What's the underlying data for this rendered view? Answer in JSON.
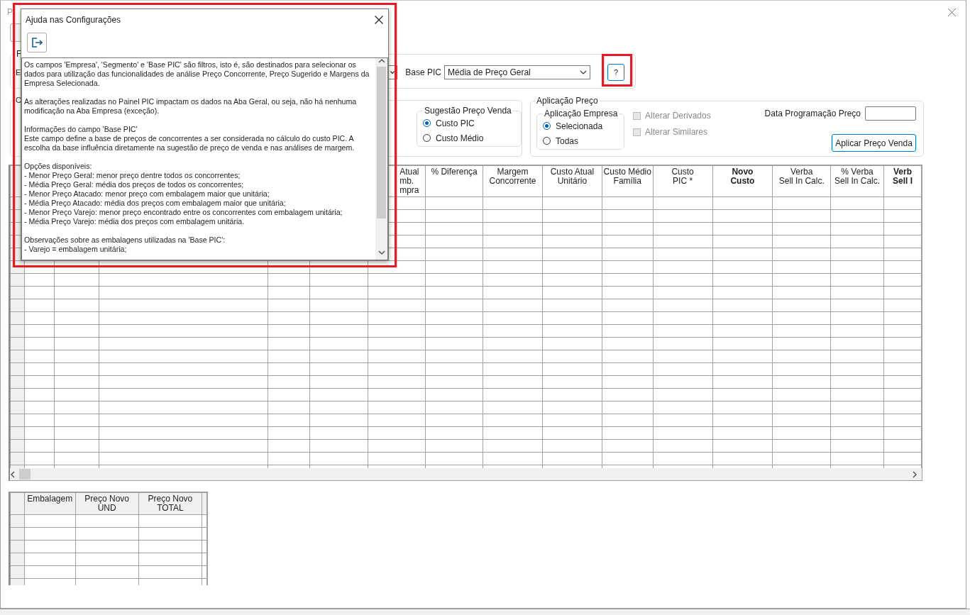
{
  "window": {
    "title": "P"
  },
  "filters": {
    "label": "F",
    "company_label": "E",
    "base_pic": {
      "label": "Base PIC",
      "value": "Média de Preço Geral"
    },
    "help_button": "?"
  },
  "config": {
    "label": "C",
    "suggestion": {
      "label": "Sugestão Preço Venda",
      "options": [
        {
          "label": "Custo PIC",
          "selected": true
        },
        {
          "label": "Custo Médio",
          "selected": false
        }
      ]
    }
  },
  "price_application": {
    "label": "Aplicação Preço",
    "company_application": {
      "label": "Aplicação Empresa",
      "options": [
        {
          "label": "Selecionada",
          "selected": true
        },
        {
          "label": "Todas",
          "selected": false
        }
      ]
    },
    "checkboxes": [
      {
        "label": "Alterar Derivados",
        "checked": false,
        "disabled": true
      },
      {
        "label": "Alterar Similares",
        "checked": false,
        "disabled": true
      }
    ],
    "date_label": "Data Programação Preço",
    "apply_button": "Aplicar Preço Venda"
  },
  "grid": {
    "columns": [
      {
        "lines": [
          "Atual",
          "mb.",
          "mpra"
        ],
        "bold": false,
        "kind": "partial"
      },
      {
        "lines": [
          "% Diferença"
        ],
        "bold": false,
        "kind": "full"
      },
      {
        "lines": [
          "Margem",
          "Concorrente"
        ],
        "bold": false,
        "kind": "full"
      },
      {
        "lines": [
          "Custo Atual",
          "Unitário"
        ],
        "bold": false,
        "kind": "full"
      },
      {
        "lines": [
          "Custo Médio",
          "Família"
        ],
        "bold": false,
        "kind": "full"
      },
      {
        "lines": [
          "Custo",
          "PIC *"
        ],
        "bold": false,
        "kind": "full"
      },
      {
        "lines": [
          "Novo",
          "Custo"
        ],
        "bold": true,
        "kind": "full"
      },
      {
        "lines": [
          "Verba",
          "Sell In Calc."
        ],
        "bold": false,
        "kind": "full"
      },
      {
        "lines": [
          "% Verba",
          "Sell In Calc."
        ],
        "bold": false,
        "kind": "full"
      },
      {
        "lines": [
          "Verb",
          "Sell I"
        ],
        "bold": true,
        "kind": "full"
      }
    ]
  },
  "packaging_grid": {
    "columns": [
      {
        "lines": [
          "Embalagem"
        ]
      },
      {
        "lines": [
          "Preço Novo",
          "UND"
        ]
      },
      {
        "lines": [
          "Preço Novo",
          "TOTAL"
        ]
      }
    ]
  },
  "dialog": {
    "title": "Ajuda nas Configurações",
    "paragraphs": [
      "Os campos 'Empresa', 'Segmento' e 'Base PIC' são filtros, isto é, são destinados para selecionar os\ndados para utilização das funcionalidades de análise Preço Concorrente, Preço Sugerido e Margens da\nEmpresa Selecionada.",
      "As alterações realizadas no Painel PIC impactam os dados na Aba Geral, ou seja, não há nenhuma\nmodificação na Aba Empresa (exceção).",
      "Informações do campo 'Base PIC'\nEste campo define a base de preços de concorrentes a ser considerada no cálculo do custo PIC. A\nescolha da base influência diretamente na sugestão de preço de venda e nas análises de margem.",
      "Opções disponíveis:\n- Menor Preço Geral: menor preço dentre todos os concorrentes;\n- Média Preço Geral: média dos preços de todos os concorrentes;\n- Menor Preço Atacado: menor preço com embalagem maior que unitária;\n- Média Preço Atacado: média dos preços com embalagem maior que unitária;\n- Menor Preço Varejo: menor preço encontrado entre os concorrentes com embalagem unitária;\n- Média Preço Varejo: média dos preços com embalagem unitária.",
      "Observações sobre as embalagens utilizadas na 'Base PIC':\n- Varejo = embalagem unitária;"
    ]
  }
}
